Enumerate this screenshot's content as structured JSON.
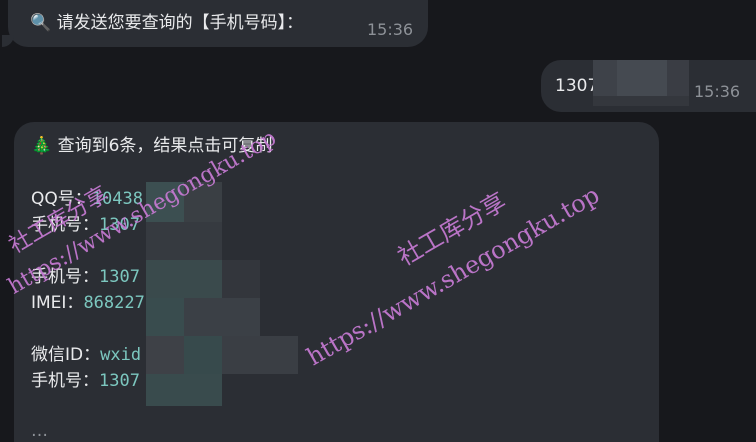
{
  "messages": {
    "prompt": {
      "icon": "magnifier-icon",
      "icon_glyph": "🔍",
      "text": "请发送您要查询的【手机号码】：",
      "time": "15:36"
    },
    "user_reply": {
      "text": "1307",
      "time": "15:36"
    },
    "result": {
      "icon": "christmas-tree-icon",
      "icon_glyph": "🎄",
      "header": "查询到6条，结果点击可复制",
      "rows": [
        {
          "label": "QQ号：",
          "value": "10438"
        },
        {
          "label": "手机号：",
          "value": "1307"
        },
        {
          "label": "手机号：",
          "value": "1307"
        },
        {
          "label": "IMEI：",
          "value": "868227"
        },
        {
          "label": "微信ID：",
          "value": "wxid"
        },
        {
          "label": "手机号：",
          "value": "1307"
        }
      ]
    }
  },
  "watermarks": {
    "text_cn": "社工库分享",
    "text_url": "https://www.shegongku.top"
  },
  "colors": {
    "background": "#17181c",
    "bubble": "#2b2e34",
    "value_text": "#7cc7bf",
    "timestamp": "#8d9197",
    "watermark": "#c77ad4"
  }
}
